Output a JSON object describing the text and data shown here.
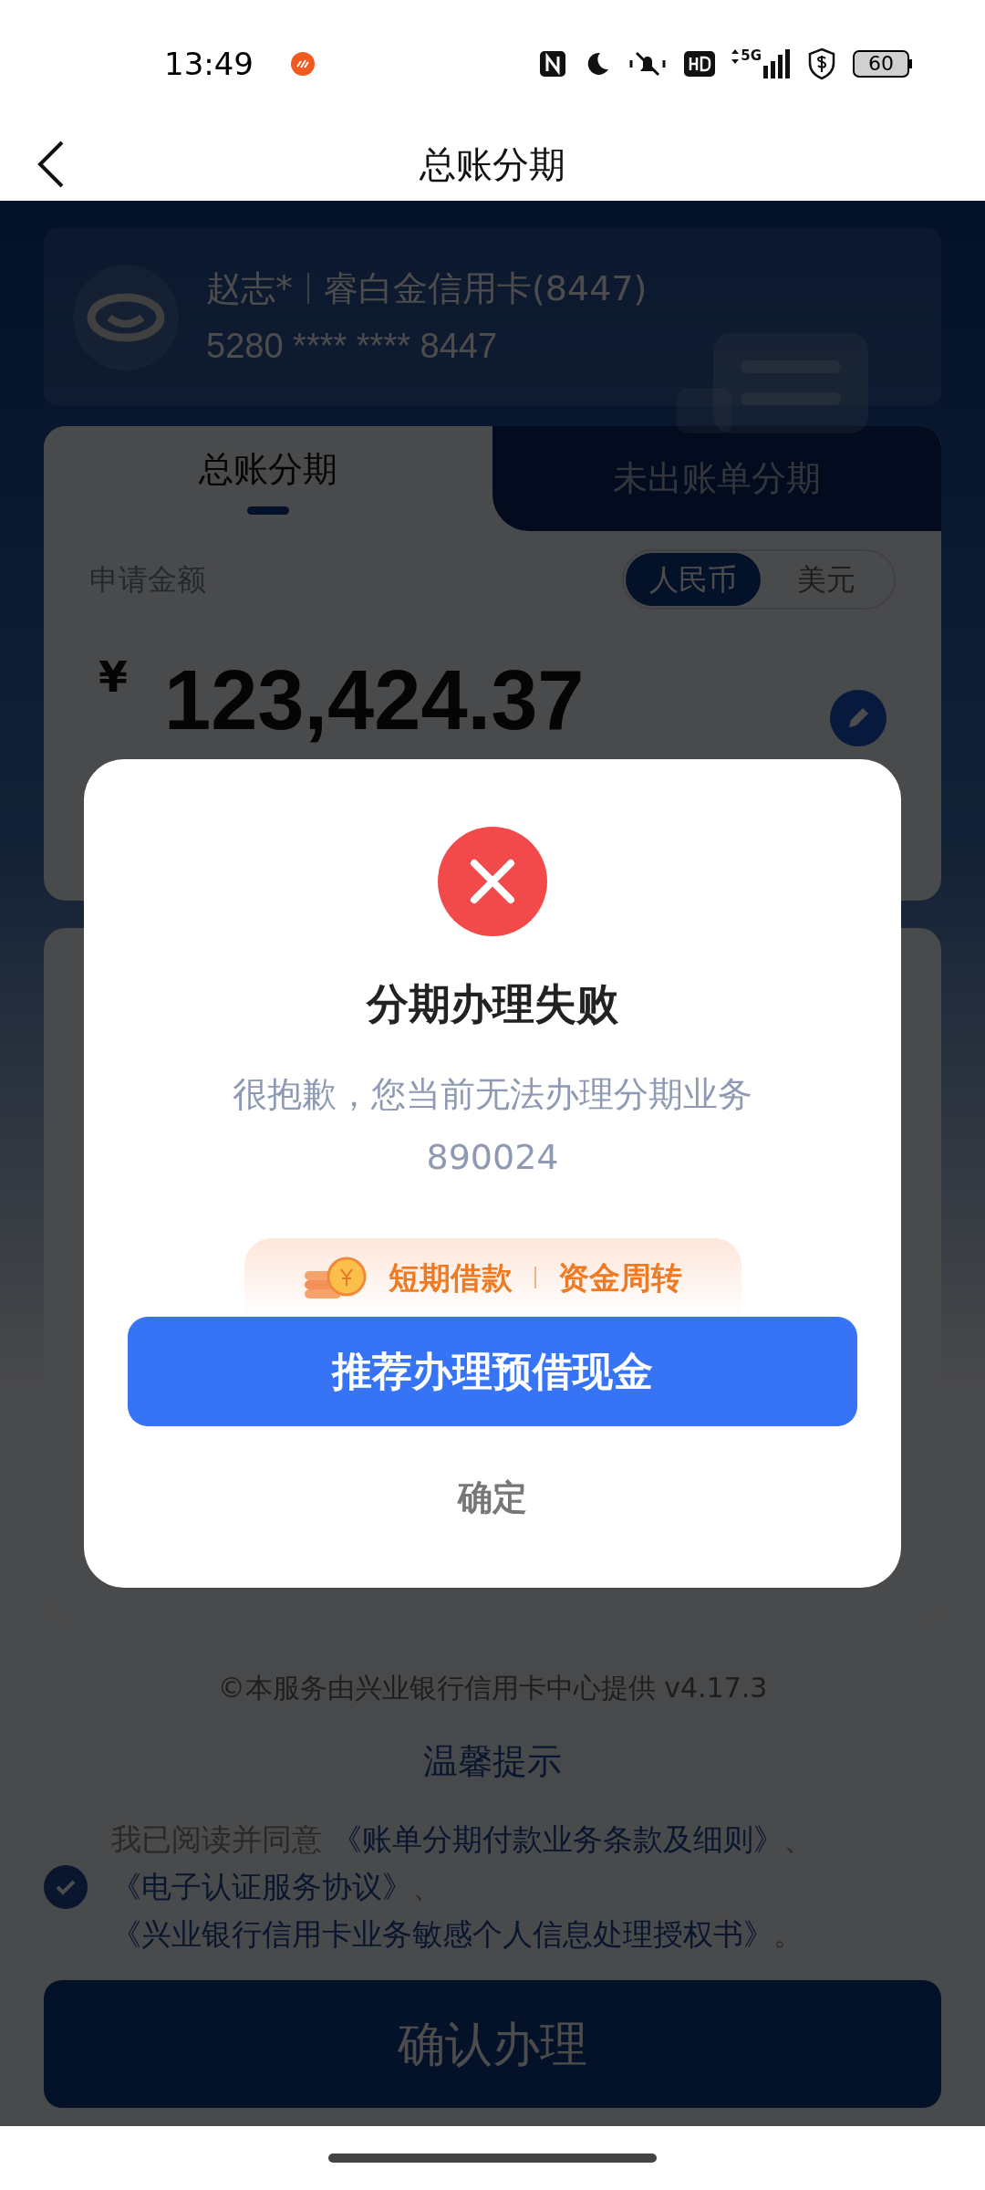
{
  "status_bar": {
    "time": "13:49",
    "network": "5G",
    "battery": "60"
  },
  "header": {
    "title": "总账分期"
  },
  "card": {
    "holder": "赵志*",
    "card_name": "睿白金信用卡(8447)",
    "number": "5280 **** **** 8447"
  },
  "tabs": [
    {
      "label": "总账分期",
      "selected": true
    },
    {
      "label": "未出账单分期",
      "selected": false
    }
  ],
  "amount": {
    "label": "申请金额",
    "currencies": [
      {
        "label": "人民币",
        "selected": true
      },
      {
        "label": "美元",
        "selected": false
      }
    ],
    "symbol": "¥",
    "value": "123,424.37"
  },
  "footer": {
    "provider": "©本服务由兴业银行信用卡中心提供 v4.17.3",
    "tips_title": "温馨提示"
  },
  "agreement": {
    "checked": true,
    "parts": [
      {
        "kind": "plain",
        "text": "我已阅读并同意"
      },
      {
        "kind": "link",
        "text": "《账单分期付款业务条款及细则》"
      },
      {
        "kind": "plain",
        "text": "、"
      },
      {
        "kind": "link",
        "text": "《电子认证服务协议》"
      },
      {
        "kind": "plain",
        "text": "、"
      },
      {
        "kind": "link",
        "text": "《兴业银行信用卡业务敏感个人信息处理授权书》"
      },
      {
        "kind": "plain",
        "text": "。"
      }
    ]
  },
  "confirm_button": "确认办理",
  "dialog": {
    "title": "分期办理失败",
    "message": "很抱歉，您当前无法办理分期业务",
    "code": "890024",
    "promo": [
      "短期借款",
      "资金周转"
    ],
    "primary_button": "推荐办理预借现金",
    "secondary_button": "确定"
  }
}
